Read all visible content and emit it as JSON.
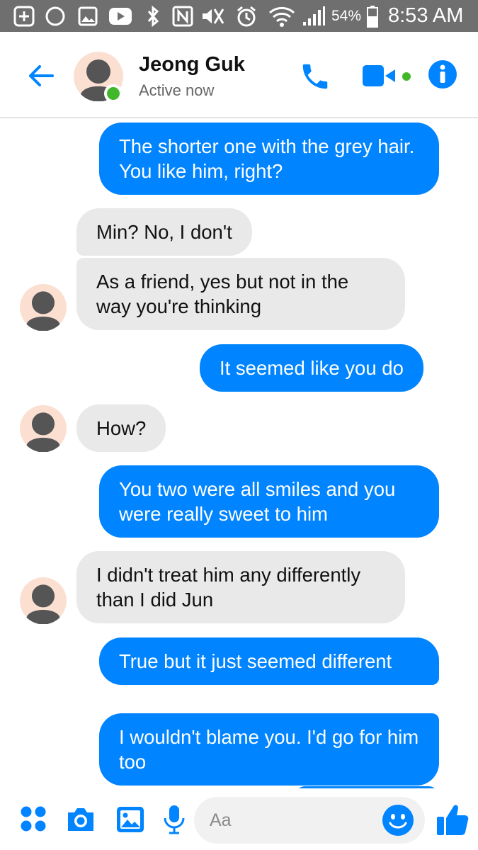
{
  "status_bar": {
    "battery_percent": "54%",
    "time": "8:53 AM",
    "icons": [
      "add-icon",
      "moon-icon",
      "image-icon",
      "youtube-icon",
      "bluetooth-icon",
      "nfc-icon",
      "mute-icon",
      "alarm-icon",
      "wifi-icon",
      "signal-icon",
      "battery-icon"
    ]
  },
  "header": {
    "contact_name": "Jeong Guk",
    "status": "Active now",
    "accent_color": "#0084ff",
    "online_color": "#42b72a"
  },
  "messages": [
    {
      "from": "me",
      "text": "The shorter one with the grey hair. You like him, right?"
    },
    {
      "from": "them",
      "text": "Min? No, I don't"
    },
    {
      "from": "them",
      "text": "As a friend, yes but not in the way you're thinking"
    },
    {
      "from": "me",
      "text": "It seemed like you do"
    },
    {
      "from": "them",
      "text": "How?"
    },
    {
      "from": "me",
      "text": "You two were all smiles and you were really sweet to him"
    },
    {
      "from": "them",
      "text": "I didn't treat him any differently than I did Jun"
    },
    {
      "from": "me",
      "text": "True but it just seemed different"
    },
    {
      "from": "me",
      "text": "I wouldn't blame you. I'd go for him too"
    }
  ],
  "composer": {
    "placeholder": "Aa",
    "icons": [
      "apps-icon",
      "camera-icon",
      "gallery-icon",
      "microphone-icon",
      "emoji-icon",
      "like-icon"
    ]
  },
  "colors": {
    "sent_bubble": "#0084ff",
    "received_bubble": "#e9e9e9",
    "status_bar": "#6f6f6f"
  }
}
